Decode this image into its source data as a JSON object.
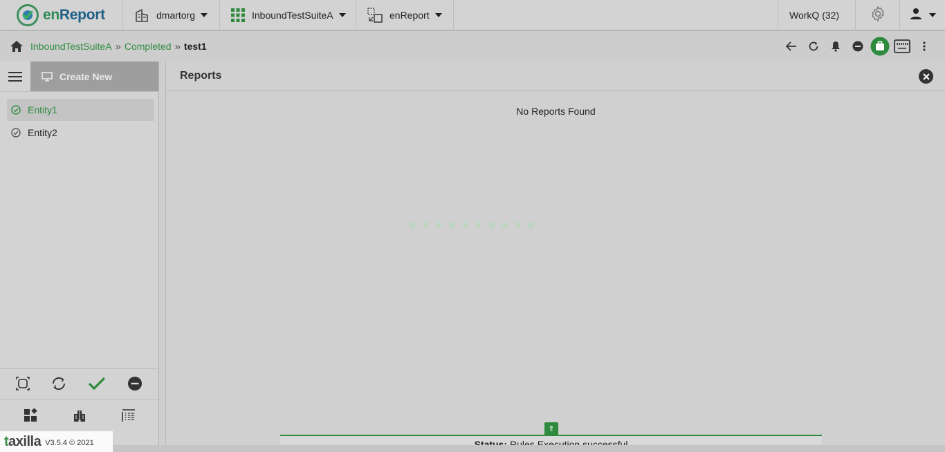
{
  "app": {
    "logo_text_en": "en",
    "logo_text_report": "Report"
  },
  "topbar": {
    "org_label": "dmartorg",
    "suite_label": "InboundTestSuiteA",
    "app_label": "enReport",
    "workq_label": "WorkQ (32)"
  },
  "breadcrumb": {
    "items": [
      "InboundTestSuiteA",
      "Completed"
    ],
    "current": "test1",
    "separator": "»"
  },
  "sidebar": {
    "create_new_label": "Create New",
    "entities": [
      {
        "label": "Entity1",
        "active": true
      },
      {
        "label": "Entity2",
        "active": false
      }
    ]
  },
  "reports": {
    "title": "Reports",
    "empty_message": "No Reports Found"
  },
  "status": {
    "label": "Status:",
    "message": "Rules Execution successful",
    "toggle_glyph": "⇑"
  },
  "footer": {
    "brand_t": "t",
    "brand_rest": "axilla",
    "version": "V3.5.4 © 2021"
  },
  "colors": {
    "accent_green": "#2e8b3e",
    "logo_blue": "#1e5f86"
  }
}
